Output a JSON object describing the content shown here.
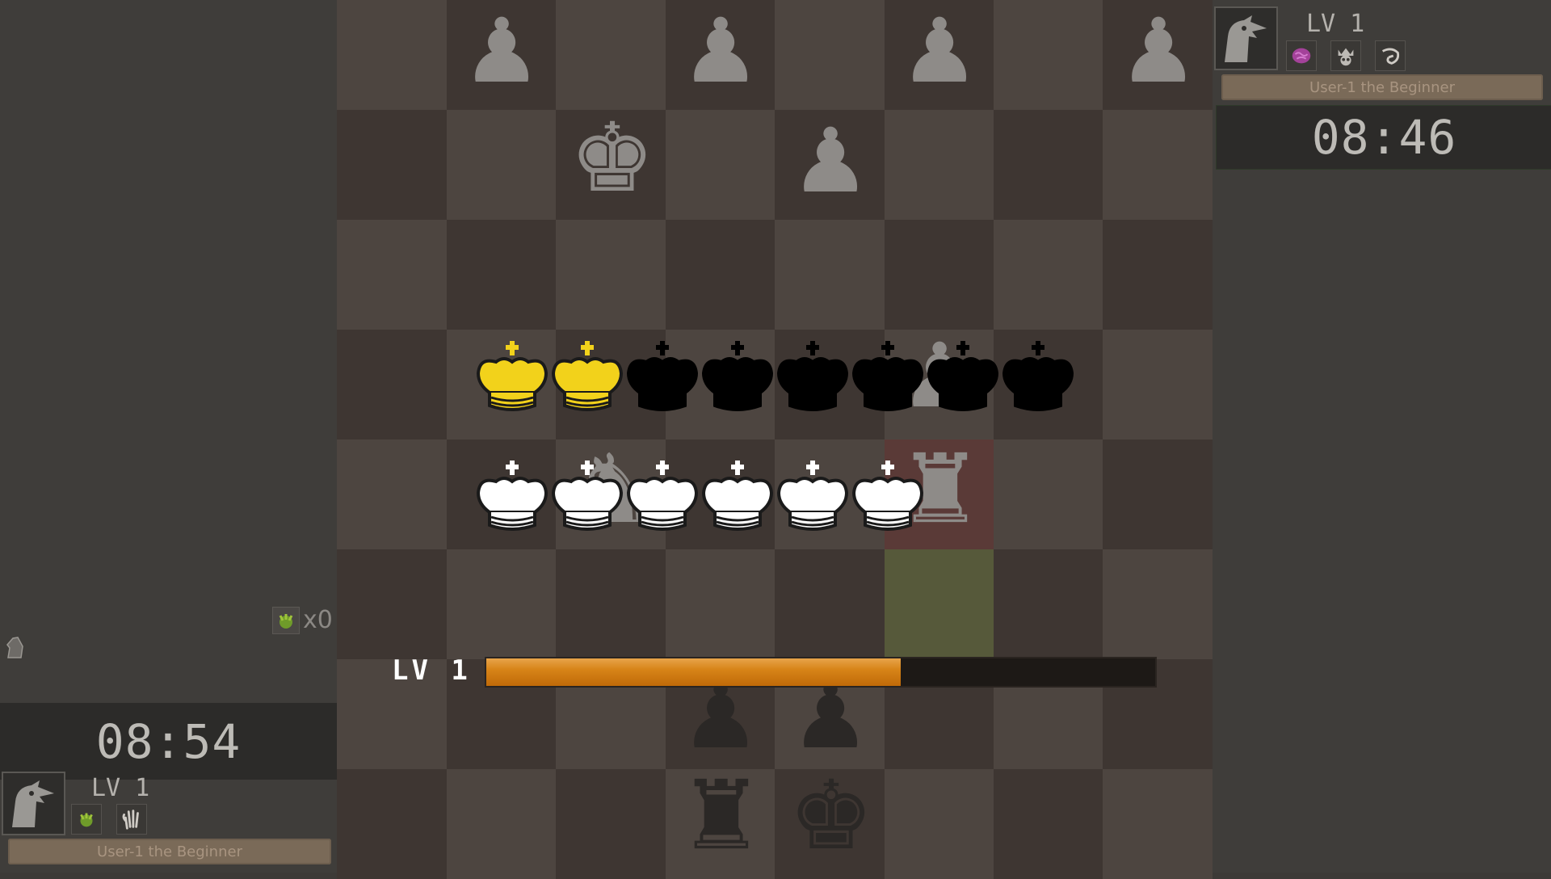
{
  "opponent": {
    "level_label": "LV 1",
    "name": "User-1 the Beginner",
    "clock": "08:46",
    "abilities": [
      "brain-icon",
      "skull-crown-icon",
      "swirl-claw-icon"
    ]
  },
  "player": {
    "level_label": "LV 1",
    "name": "User-1 the Beginner",
    "clock": "08:54",
    "abilities": [
      "green-claw-icon",
      "hand-icon"
    ],
    "counter_text": "x0"
  },
  "xp": {
    "level_text": "LV 1",
    "fill_fraction": 0.62
  },
  "colors": {
    "gold": "#f2d21b",
    "xp_orange": "#e08a1c",
    "highlight_red": "#5a3a37",
    "highlight_green": "#56593a"
  },
  "effect_rows": {
    "top_row": [
      "gold",
      "gold",
      "black",
      "black",
      "black",
      "black",
      "black",
      "black"
    ],
    "bottom_row": [
      "white",
      "white",
      "white",
      "white",
      "white",
      "white"
    ]
  }
}
